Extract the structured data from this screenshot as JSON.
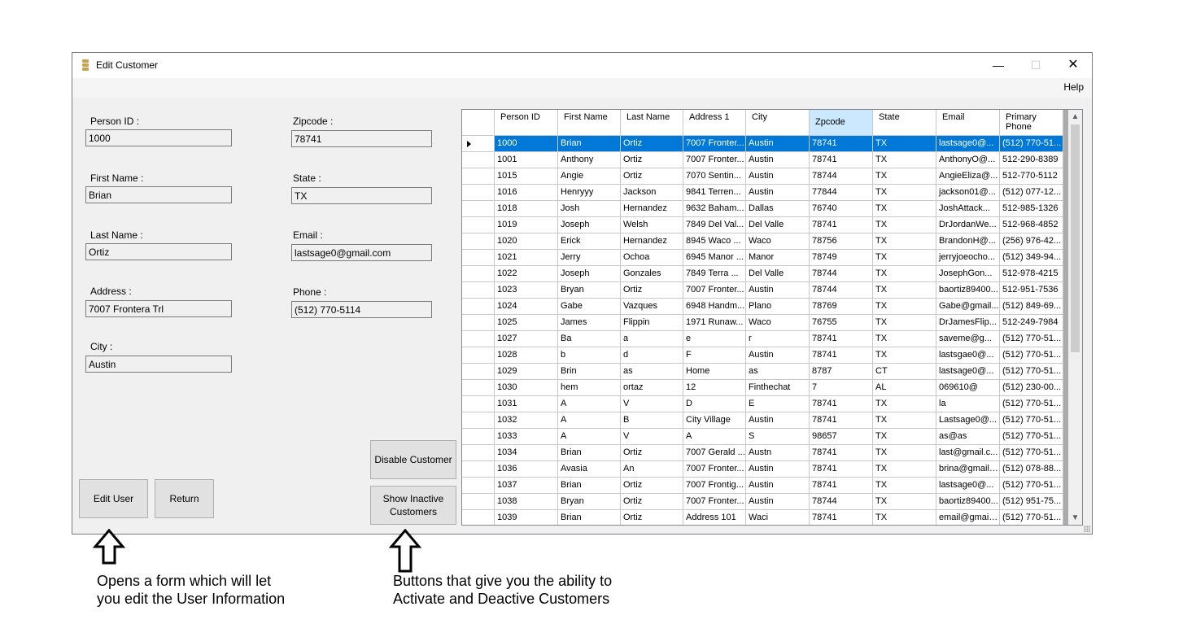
{
  "window": {
    "title": "Edit Customer",
    "menu": [
      "Help"
    ]
  },
  "form": {
    "person_id": {
      "label": "Person ID :",
      "value": "1000"
    },
    "first_name": {
      "label": "First Name :",
      "value": "Brian"
    },
    "last_name": {
      "label": "Last Name :",
      "value": "Ortiz"
    },
    "address": {
      "label": "Address :",
      "value": "7007 Frontera Trl"
    },
    "city": {
      "label": "City :",
      "value": "Austin"
    },
    "zipcode": {
      "label": "Zipcode :",
      "value": "78741"
    },
    "state": {
      "label": "State :",
      "value": "TX"
    },
    "email": {
      "label": "Email :",
      "value": "lastsage0@gmail.com"
    },
    "phone": {
      "label": "Phone :",
      "value": "(512) 770-5114"
    }
  },
  "buttons": {
    "edit_user": "Edit User",
    "return": "Return",
    "disable_customer": "Disable Customer",
    "show_inactive": "Show Inactive Customers"
  },
  "grid": {
    "columns": [
      {
        "key": "id",
        "label": "Person ID"
      },
      {
        "key": "first",
        "label": "First Name"
      },
      {
        "key": "last",
        "label": "Last Name"
      },
      {
        "key": "address",
        "label": "Address 1"
      },
      {
        "key": "city",
        "label": "City"
      },
      {
        "key": "zip",
        "label": "Zpcode"
      },
      {
        "key": "state",
        "label": "State"
      },
      {
        "key": "email",
        "label": "Email"
      },
      {
        "key": "phone",
        "label": "Primary Phone"
      }
    ],
    "selected_row": 0,
    "selected_column_header": "Zpcode",
    "rows": [
      [
        "1000",
        "Brian",
        "Ortiz",
        "7007 Fronter...",
        "Austin",
        "78741",
        "TX",
        "lastsage0@...",
        "(512) 770-51..."
      ],
      [
        "1001",
        "Anthony",
        "Ortiz",
        "7007 Fronter...",
        "Austin",
        "78741",
        "TX",
        "AnthonyO@...",
        "512-290-8389"
      ],
      [
        "1015",
        "Angie",
        "Ortiz",
        "7070 Sentin...",
        "Austin",
        "78744",
        "TX",
        "AngieEliza@...",
        "512-770-5112"
      ],
      [
        "1016",
        "Henryyy",
        "Jackson",
        "9841 Terren...",
        "Austin",
        "77844",
        "TX",
        "jackson01@...",
        "(512) 077-12..."
      ],
      [
        "1018",
        "Josh",
        "Hernandez",
        "9632 Baham...",
        "Dallas",
        "76740",
        "TX",
        "JoshAttack...",
        "512-985-1326"
      ],
      [
        "1019",
        "Joseph",
        "Welsh",
        "7849 Del Val...",
        "Del Valle",
        "78741",
        "TX",
        "DrJordanWe...",
        "512-968-4852"
      ],
      [
        "1020",
        "Erick",
        "Hernandez",
        "8945 Waco ...",
        "Waco",
        "78756",
        "TX",
        "BrandonH@...",
        "(256) 976-42..."
      ],
      [
        "1021",
        "Jerry",
        "Ochoa",
        "6945 Manor ...",
        "Manor",
        "78749",
        "TX",
        "jerryjoeocho...",
        "(512) 349-94..."
      ],
      [
        "1022",
        "Joseph",
        "Gonzales",
        "7849 Terra ...",
        "Del Valle",
        "78744",
        "TX",
        "JosephGon...",
        "512-978-4215"
      ],
      [
        "1023",
        "Bryan",
        "Ortiz",
        "7007 Fronter...",
        "Austin",
        "78744",
        "TX",
        "baortiz89400...",
        "512-951-7536"
      ],
      [
        "1024",
        "Gabe",
        "Vazques",
        "6948 Handm...",
        "Plano",
        "78769",
        "TX",
        "Gabe@gmail...",
        "(512) 849-69..."
      ],
      [
        "1025",
        "James",
        "Flippin",
        "1971 Runaw...",
        "Waco",
        "76755",
        "TX",
        "DrJamesFlip...",
        "512-249-7984"
      ],
      [
        "1027",
        "Ba",
        "a",
        "e",
        "r",
        "78741",
        "TX",
        "saveme@g...",
        "(512) 770-51..."
      ],
      [
        "1028",
        "b",
        "d",
        "F",
        "Austin",
        "78741",
        "TX",
        "lastsgae0@...",
        "(512) 770-51..."
      ],
      [
        "1029",
        "Brin",
        "as",
        "Home",
        "as",
        "8787",
        "CT",
        "lastsage0@...",
        "(512) 770-51..."
      ],
      [
        "1030",
        "hem",
        "ortaz",
        "12",
        "Finthechat",
        "7",
        "AL",
        "069610@",
        "(512) 230-00..."
      ],
      [
        "1031",
        "A",
        "V",
        "D",
        "E",
        "78741",
        "TX",
        "la",
        "(512) 770-51..."
      ],
      [
        "1032",
        "A",
        "B",
        "City Village",
        "Austin",
        "78741",
        "TX",
        "Lastsage0@...",
        "(512) 770-51..."
      ],
      [
        "1033",
        "A",
        "V",
        "A",
        "S",
        "98657",
        "TX",
        "as@as",
        "(512) 770-51..."
      ],
      [
        "1034",
        "Brian",
        "Ortiz",
        "7007 Gerald ...",
        "Austn",
        "78741",
        "TX",
        "last@gmail.c...",
        "(512) 770-51..."
      ],
      [
        "1036",
        "Avasia",
        "An",
        "7007 Fronter...",
        "Austin",
        "78741",
        "TX",
        "brina@gmail....",
        "(512) 078-88..."
      ],
      [
        "1037",
        "Brian",
        "Ortiz",
        "7007 Frontig...",
        "Austin",
        "78741",
        "TX",
        "lastsage0@...",
        "(512) 770-51..."
      ],
      [
        "1038",
        "Bryan",
        "Ortiz",
        "7007 Fronter...",
        "Austin",
        "78744",
        "TX",
        "baortiz89400...",
        "(512) 951-75..."
      ],
      [
        "1039",
        "Brian",
        "Ortiz",
        "Address 101",
        "Waci",
        "78741",
        "TX",
        "email@gmail....",
        "(512) 770-51..."
      ]
    ]
  },
  "annotations": {
    "left": "Opens a form which will let you edit the User Information",
    "right": "Buttons that give you the ability to Activate and Deactive Customers"
  },
  "colors": {
    "selection": "#0078d7",
    "selected_header": "#cce8ff",
    "window_bg": "#f0f0f0"
  }
}
